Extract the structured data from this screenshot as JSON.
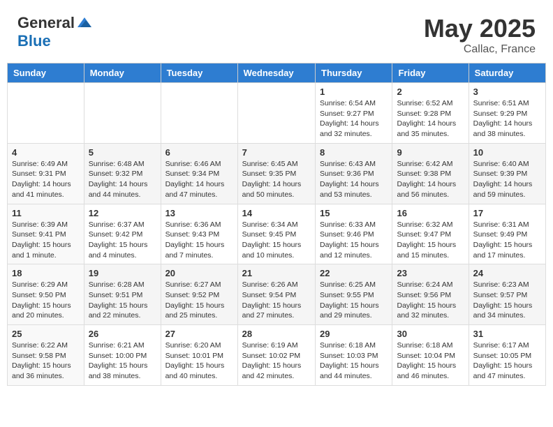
{
  "header": {
    "logo_general": "General",
    "logo_blue": "Blue",
    "month": "May 2025",
    "location": "Callac, France"
  },
  "weekdays": [
    "Sunday",
    "Monday",
    "Tuesday",
    "Wednesday",
    "Thursday",
    "Friday",
    "Saturday"
  ],
  "weeks": [
    [
      {
        "day": "",
        "info": ""
      },
      {
        "day": "",
        "info": ""
      },
      {
        "day": "",
        "info": ""
      },
      {
        "day": "",
        "info": ""
      },
      {
        "day": "1",
        "info": "Sunrise: 6:54 AM\nSunset: 9:27 PM\nDaylight: 14 hours\nand 32 minutes."
      },
      {
        "day": "2",
        "info": "Sunrise: 6:52 AM\nSunset: 9:28 PM\nDaylight: 14 hours\nand 35 minutes."
      },
      {
        "day": "3",
        "info": "Sunrise: 6:51 AM\nSunset: 9:29 PM\nDaylight: 14 hours\nand 38 minutes."
      }
    ],
    [
      {
        "day": "4",
        "info": "Sunrise: 6:49 AM\nSunset: 9:31 PM\nDaylight: 14 hours\nand 41 minutes."
      },
      {
        "day": "5",
        "info": "Sunrise: 6:48 AM\nSunset: 9:32 PM\nDaylight: 14 hours\nand 44 minutes."
      },
      {
        "day": "6",
        "info": "Sunrise: 6:46 AM\nSunset: 9:34 PM\nDaylight: 14 hours\nand 47 minutes."
      },
      {
        "day": "7",
        "info": "Sunrise: 6:45 AM\nSunset: 9:35 PM\nDaylight: 14 hours\nand 50 minutes."
      },
      {
        "day": "8",
        "info": "Sunrise: 6:43 AM\nSunset: 9:36 PM\nDaylight: 14 hours\nand 53 minutes."
      },
      {
        "day": "9",
        "info": "Sunrise: 6:42 AM\nSunset: 9:38 PM\nDaylight: 14 hours\nand 56 minutes."
      },
      {
        "day": "10",
        "info": "Sunrise: 6:40 AM\nSunset: 9:39 PM\nDaylight: 14 hours\nand 59 minutes."
      }
    ],
    [
      {
        "day": "11",
        "info": "Sunrise: 6:39 AM\nSunset: 9:41 PM\nDaylight: 15 hours\nand 1 minute."
      },
      {
        "day": "12",
        "info": "Sunrise: 6:37 AM\nSunset: 9:42 PM\nDaylight: 15 hours\nand 4 minutes."
      },
      {
        "day": "13",
        "info": "Sunrise: 6:36 AM\nSunset: 9:43 PM\nDaylight: 15 hours\nand 7 minutes."
      },
      {
        "day": "14",
        "info": "Sunrise: 6:34 AM\nSunset: 9:45 PM\nDaylight: 15 hours\nand 10 minutes."
      },
      {
        "day": "15",
        "info": "Sunrise: 6:33 AM\nSunset: 9:46 PM\nDaylight: 15 hours\nand 12 minutes."
      },
      {
        "day": "16",
        "info": "Sunrise: 6:32 AM\nSunset: 9:47 PM\nDaylight: 15 hours\nand 15 minutes."
      },
      {
        "day": "17",
        "info": "Sunrise: 6:31 AM\nSunset: 9:49 PM\nDaylight: 15 hours\nand 17 minutes."
      }
    ],
    [
      {
        "day": "18",
        "info": "Sunrise: 6:29 AM\nSunset: 9:50 PM\nDaylight: 15 hours\nand 20 minutes."
      },
      {
        "day": "19",
        "info": "Sunrise: 6:28 AM\nSunset: 9:51 PM\nDaylight: 15 hours\nand 22 minutes."
      },
      {
        "day": "20",
        "info": "Sunrise: 6:27 AM\nSunset: 9:52 PM\nDaylight: 15 hours\nand 25 minutes."
      },
      {
        "day": "21",
        "info": "Sunrise: 6:26 AM\nSunset: 9:54 PM\nDaylight: 15 hours\nand 27 minutes."
      },
      {
        "day": "22",
        "info": "Sunrise: 6:25 AM\nSunset: 9:55 PM\nDaylight: 15 hours\nand 29 minutes."
      },
      {
        "day": "23",
        "info": "Sunrise: 6:24 AM\nSunset: 9:56 PM\nDaylight: 15 hours\nand 32 minutes."
      },
      {
        "day": "24",
        "info": "Sunrise: 6:23 AM\nSunset: 9:57 PM\nDaylight: 15 hours\nand 34 minutes."
      }
    ],
    [
      {
        "day": "25",
        "info": "Sunrise: 6:22 AM\nSunset: 9:58 PM\nDaylight: 15 hours\nand 36 minutes."
      },
      {
        "day": "26",
        "info": "Sunrise: 6:21 AM\nSunset: 10:00 PM\nDaylight: 15 hours\nand 38 minutes."
      },
      {
        "day": "27",
        "info": "Sunrise: 6:20 AM\nSunset: 10:01 PM\nDaylight: 15 hours\nand 40 minutes."
      },
      {
        "day": "28",
        "info": "Sunrise: 6:19 AM\nSunset: 10:02 PM\nDaylight: 15 hours\nand 42 minutes."
      },
      {
        "day": "29",
        "info": "Sunrise: 6:18 AM\nSunset: 10:03 PM\nDaylight: 15 hours\nand 44 minutes."
      },
      {
        "day": "30",
        "info": "Sunrise: 6:18 AM\nSunset: 10:04 PM\nDaylight: 15 hours\nand 46 minutes."
      },
      {
        "day": "31",
        "info": "Sunrise: 6:17 AM\nSunset: 10:05 PM\nDaylight: 15 hours\nand 47 minutes."
      }
    ]
  ]
}
